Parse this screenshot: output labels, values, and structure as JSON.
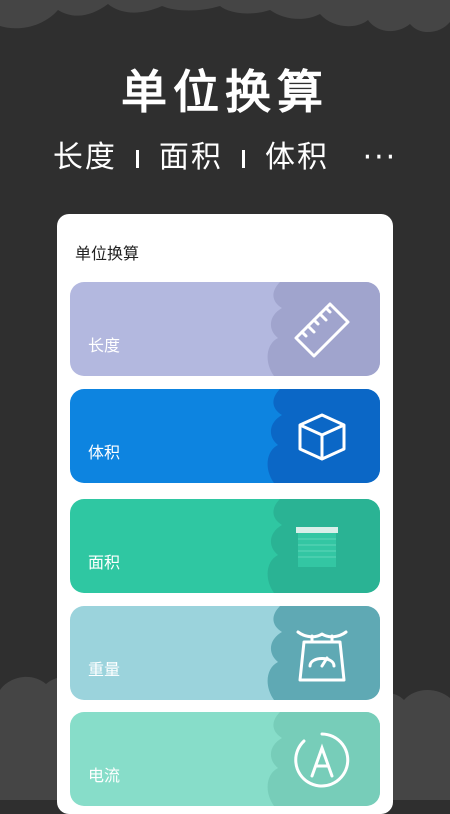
{
  "hero": {
    "title": "单位换算",
    "subtitle": {
      "items": [
        "长度",
        "面积",
        "体积"
      ],
      "more": "···"
    }
  },
  "panel": {
    "title": "单位换算",
    "cards": [
      {
        "label": "长度",
        "icon": "ruler-icon",
        "color": "#b3b8df",
        "shade": "#a0a4cd"
      },
      {
        "label": "体积",
        "icon": "cube-icon",
        "color": "#0d84e0",
        "shade": "#0b67c6"
      },
      {
        "label": "面积",
        "icon": "area-icon",
        "color": "#2fc7a2",
        "shade": "#2ab394"
      },
      {
        "label": "重量",
        "icon": "scale-icon",
        "color": "#9bd3dc",
        "shade": "#5fa9b4"
      },
      {
        "label": "电流",
        "icon": "current-icon",
        "color": "#87ddc9",
        "shade": "#77cdb9"
      }
    ]
  },
  "colors": {
    "background": "#2f2f2f",
    "cloud": "#454545",
    "panel": "#ffffff"
  }
}
